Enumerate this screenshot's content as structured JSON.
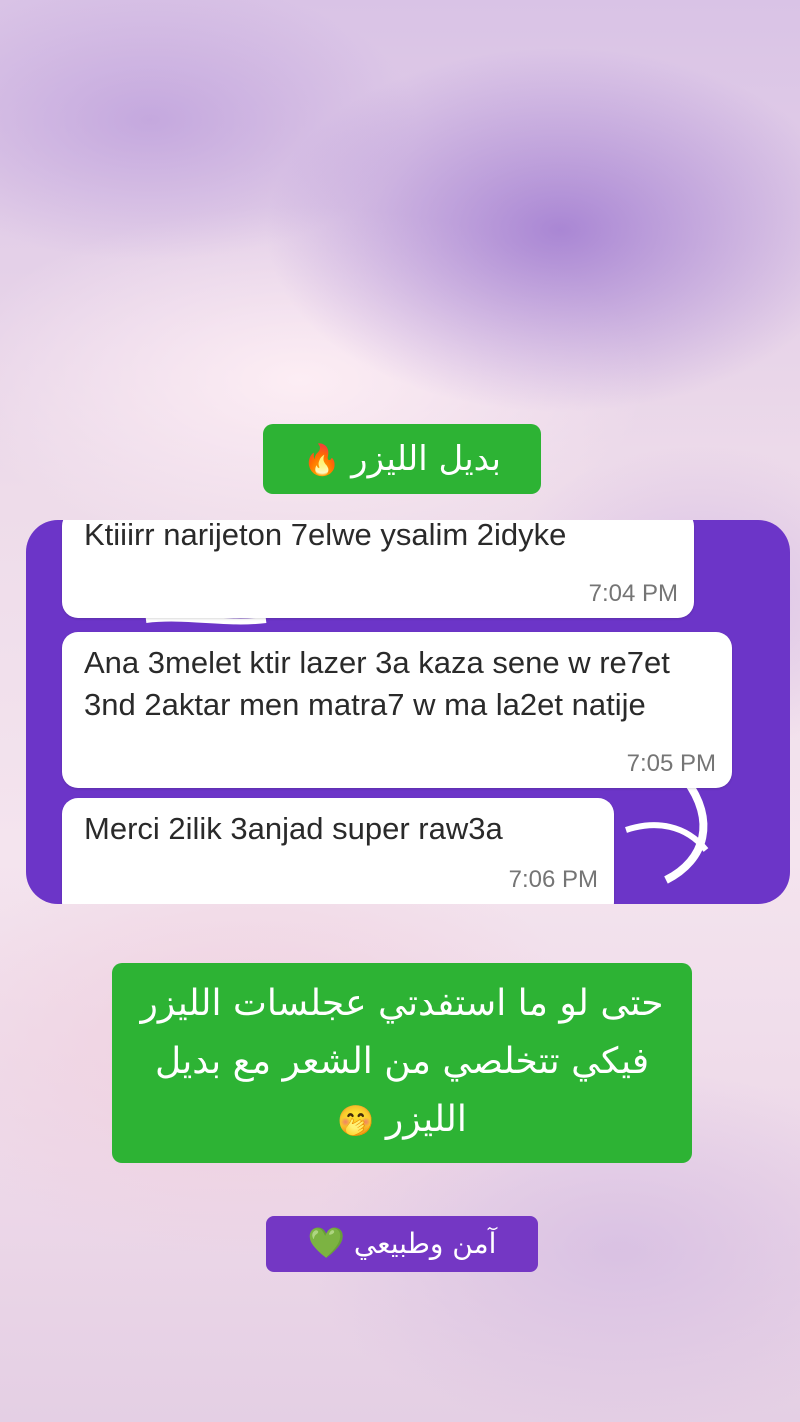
{
  "headline": {
    "text": "بديل الليزر",
    "emoji": "🔥"
  },
  "chat": {
    "messages": [
      {
        "text": "Ktiiirr narijeton 7elwe ysalim 2idyke",
        "time": "7:04 PM"
      },
      {
        "text": "Ana 3melet ktir lazer 3a kaza sene  w re7et 3nd 2aktar men matra7 w ma la2et natije",
        "time": "7:05 PM"
      },
      {
        "text": "Merci 2ilik 3anjad super raw3a",
        "time": "7:06 PM"
      }
    ]
  },
  "middle_caption": {
    "line1": "حتى لو ما استفدتي عجلسات الليزر",
    "line2": "فيكي تتخلصي من الشعر مع بديل",
    "line3": "الليزر",
    "emoji": "🤭"
  },
  "tagline": {
    "text": "آمن وطبيعي",
    "emoji": "💚"
  },
  "colors": {
    "green": "#2db334",
    "purple": "#6c35c8",
    "tag_purple": "#7437c4"
  }
}
